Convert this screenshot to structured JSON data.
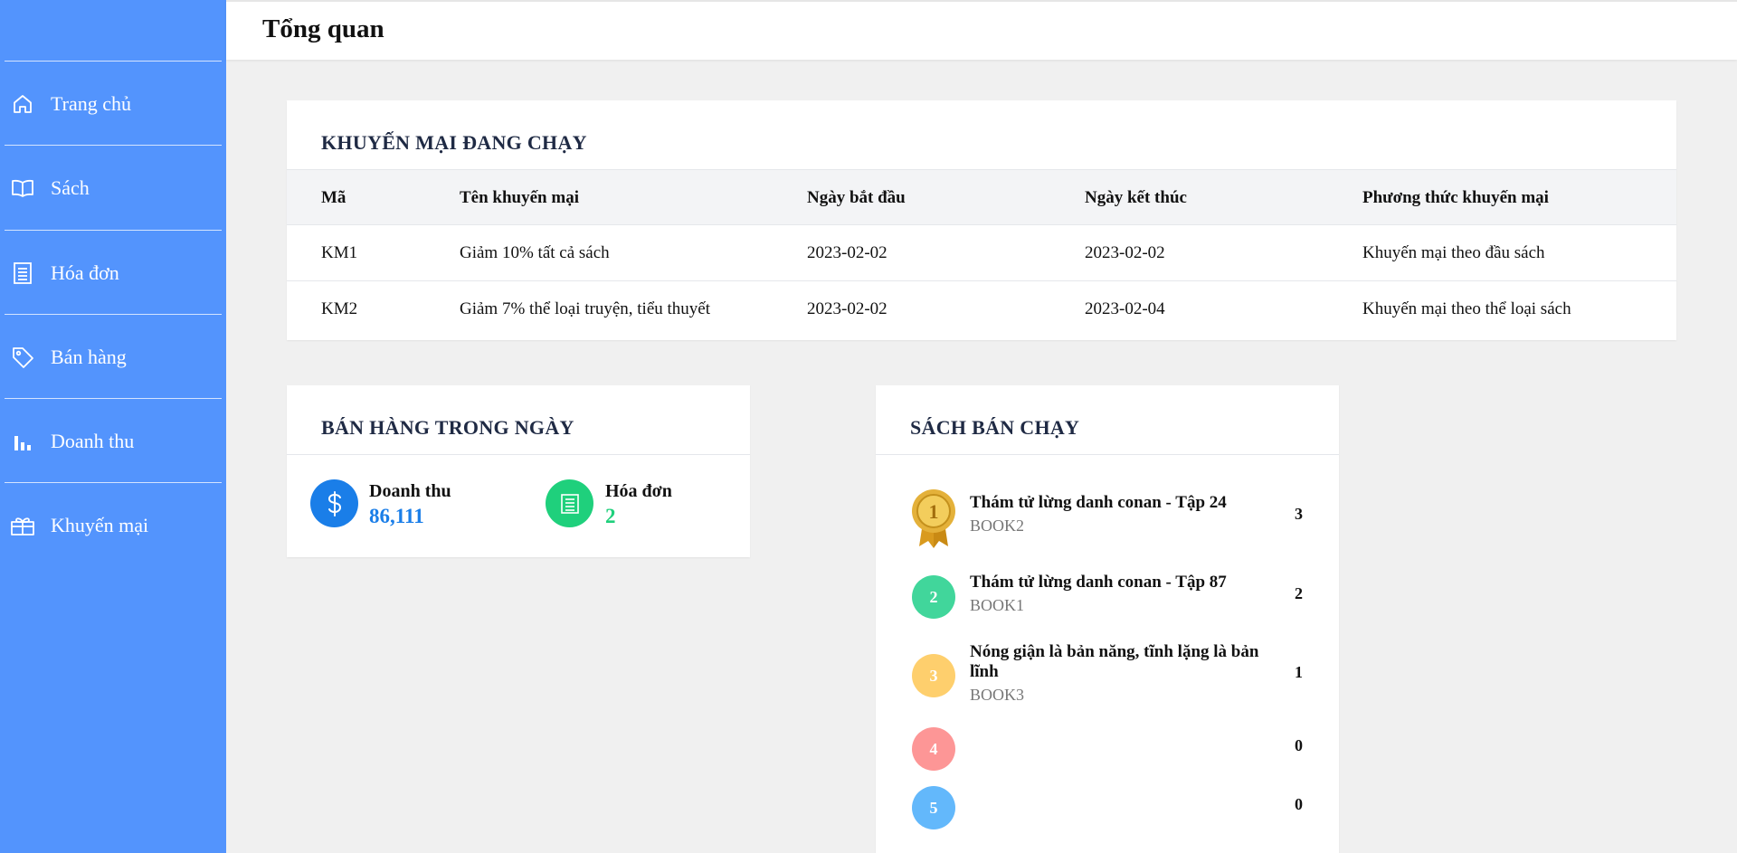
{
  "sidebar": {
    "items": [
      {
        "label": "Trang chủ",
        "icon": "home-icon"
      },
      {
        "label": "Sách",
        "icon": "book-icon"
      },
      {
        "label": "Hóa đơn",
        "icon": "receipt-icon"
      },
      {
        "label": "Bán hàng",
        "icon": "tag-icon"
      },
      {
        "label": "Doanh thu",
        "icon": "bar-chart-icon"
      },
      {
        "label": "Khuyến mại",
        "icon": "gift-icon"
      }
    ]
  },
  "header": {
    "title": "Tổng quan"
  },
  "promotions": {
    "title": "KHUYẾN MẠI ĐANG CHẠY",
    "columns": [
      "Mã",
      "Tên khuyến mại",
      "Ngày bắt đầu",
      "Ngày kết thúc",
      "Phương thức khuyến mại"
    ],
    "rows": [
      [
        "KM1",
        "Giảm 10% tất cả sách",
        "2023-02-02",
        "2023-02-02",
        "Khuyến mại theo đầu sách"
      ],
      [
        "KM2",
        "Giảm 7% thể loại truyện, tiểu thuyết",
        "2023-02-02",
        "2023-02-04",
        "Khuyến mại theo thể loại sách"
      ]
    ]
  },
  "daily_sales": {
    "title": "BÁN HÀNG TRONG NGÀY",
    "revenue_label": "Doanh thu",
    "revenue_value": "86,111",
    "invoice_label": "Hóa đơn",
    "invoice_value": "2"
  },
  "best_sellers": {
    "title": "SÁCH BÁN CHẠY",
    "items": [
      {
        "rank": "1",
        "name": "Thám tử lừng danh conan - Tập 24",
        "code": "BOOK2",
        "qty": "3"
      },
      {
        "rank": "2",
        "name": "Thám tử lừng danh conan - Tập 87",
        "code": "BOOK1",
        "qty": "2"
      },
      {
        "rank": "3",
        "name": "Nóng giận là bản năng, tĩnh lặng là bản lĩnh",
        "code": "BOOK3",
        "qty": "1"
      },
      {
        "rank": "4",
        "name": "",
        "code": "",
        "qty": "0"
      },
      {
        "rank": "5",
        "name": "",
        "code": "",
        "qty": "0"
      }
    ]
  },
  "colors": {
    "sidebar": "#5394fd",
    "revenue": "#1a7ee8",
    "invoice": "#1fd07c",
    "rank2": "#41d69b",
    "rank3": "#fecf6d",
    "rank4": "#fd9696",
    "rank5": "#63b8fb",
    "medal": "#e4b13a"
  }
}
